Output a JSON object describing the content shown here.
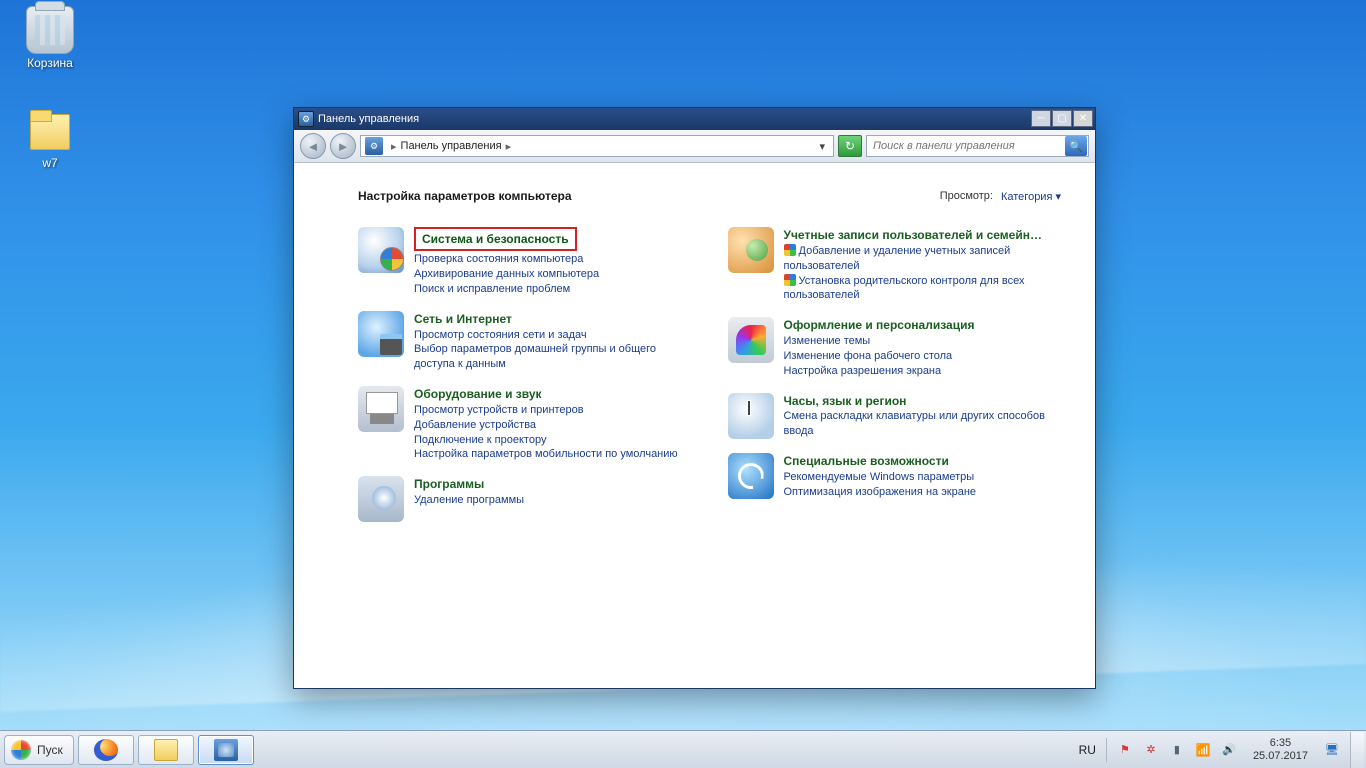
{
  "desktop": {
    "recycle_label": "Корзина",
    "folder_label": "w7"
  },
  "window": {
    "title": "Панель управления",
    "breadcrumb": "Панель управления",
    "search_placeholder": "Поиск в панели управления",
    "heading": "Настройка параметров компьютера",
    "view_label": "Просмотр:",
    "view_value": "Категория"
  },
  "left": [
    {
      "title": "Система и безопасность",
      "highlight": true,
      "links": [
        "Проверка состояния компьютера",
        "Архивирование данных компьютера",
        "Поиск и исправление проблем"
      ]
    },
    {
      "title": "Сеть и Интернет",
      "links": [
        "Просмотр состояния сети и задач",
        "Выбор параметров домашней группы и общего доступа к данным"
      ]
    },
    {
      "title": "Оборудование и звук",
      "links": [
        "Просмотр устройств и принтеров",
        "Добавление устройства",
        "Подключение к проектору",
        "Настройка параметров мобильности по умолчанию"
      ]
    },
    {
      "title": "Программы",
      "links": [
        "Удаление программы"
      ]
    }
  ],
  "right": [
    {
      "title": "Учетные записи пользователей и семейн…",
      "shield_links": [
        "Добавление и удаление учетных записей пользователей",
        "Установка родительского контроля для всех пользователей"
      ]
    },
    {
      "title": "Оформление и персонализация",
      "links": [
        "Изменение темы",
        "Изменение фона рабочего стола",
        "Настройка разрешения экрана"
      ]
    },
    {
      "title": "Часы, язык и регион",
      "links": [
        "Смена раскладки клавиатуры или других способов ввода"
      ]
    },
    {
      "title": "Специальные возможности",
      "links": [
        "Рекомендуемые Windows параметры",
        "Оптимизация изображения на экране"
      ]
    }
  ],
  "taskbar": {
    "start": "Пуск",
    "lang": "RU",
    "time": "6:35",
    "date": "25.07.2017"
  }
}
